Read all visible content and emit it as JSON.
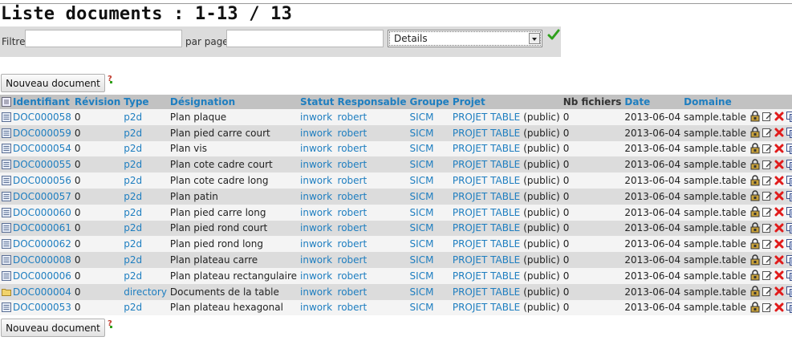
{
  "page_title": "Liste documents : 1-13 / 13",
  "filter": {
    "filtre_label": "Filtre",
    "filtre_value": "",
    "par_page_label": "par page",
    "par_page_value": "",
    "view_selected": "Details"
  },
  "new_button_label": "Nouveau document",
  "columns": {
    "identifiant": "Identifiant",
    "revision": "Révision",
    "type": "Type",
    "designation": "Désignation",
    "statut": "Statut",
    "responsable": "Responsable",
    "groupe": "Groupe",
    "projet": "Projet",
    "nb_fichiers": "Nb fichiers",
    "date": "Date",
    "domaine": "Domaine"
  },
  "rows": [
    {
      "id": "DOC000058",
      "rev": "0",
      "type": "p2d",
      "icon": "document-icon",
      "designation": "Plan plaque",
      "statut": "inwork",
      "responsable": "robert",
      "groupe": "SICM",
      "projet": "PROJET TABLE",
      "visibilite": "(public)",
      "nb": "0",
      "date": "2013-06-04",
      "domaine": "sample.table"
    },
    {
      "id": "DOC000059",
      "rev": "0",
      "type": "p2d",
      "icon": "document-icon",
      "designation": "Plan pied carre court",
      "statut": "inwork",
      "responsable": "robert",
      "groupe": "SICM",
      "projet": "PROJET TABLE",
      "visibilite": "(public)",
      "nb": "0",
      "date": "2013-06-04",
      "domaine": "sample.table"
    },
    {
      "id": "DOC000054",
      "rev": "0",
      "type": "p2d",
      "icon": "document-icon",
      "designation": "Plan vis",
      "statut": "inwork",
      "responsable": "robert",
      "groupe": "SICM",
      "projet": "PROJET TABLE",
      "visibilite": "(public)",
      "nb": "0",
      "date": "2013-06-04",
      "domaine": "sample.table"
    },
    {
      "id": "DOC000055",
      "rev": "0",
      "type": "p2d",
      "icon": "document-icon",
      "designation": "Plan cote cadre court",
      "statut": "inwork",
      "responsable": "robert",
      "groupe": "SICM",
      "projet": "PROJET TABLE",
      "visibilite": "(public)",
      "nb": "0",
      "date": "2013-06-04",
      "domaine": "sample.table"
    },
    {
      "id": "DOC000056",
      "rev": "0",
      "type": "p2d",
      "icon": "document-icon",
      "designation": "Plan cote cadre long",
      "statut": "inwork",
      "responsable": "robert",
      "groupe": "SICM",
      "projet": "PROJET TABLE",
      "visibilite": "(public)",
      "nb": "0",
      "date": "2013-06-04",
      "domaine": "sample.table"
    },
    {
      "id": "DOC000057",
      "rev": "0",
      "type": "p2d",
      "icon": "document-icon",
      "designation": "Plan patin",
      "statut": "inwork",
      "responsable": "robert",
      "groupe": "SICM",
      "projet": "PROJET TABLE",
      "visibilite": "(public)",
      "nb": "0",
      "date": "2013-06-04",
      "domaine": "sample.table"
    },
    {
      "id": "DOC000060",
      "rev": "0",
      "type": "p2d",
      "icon": "document-icon",
      "designation": "Plan pied carre long",
      "statut": "inwork",
      "responsable": "robert",
      "groupe": "SICM",
      "projet": "PROJET TABLE",
      "visibilite": "(public)",
      "nb": "0",
      "date": "2013-06-04",
      "domaine": "sample.table"
    },
    {
      "id": "DOC000061",
      "rev": "0",
      "type": "p2d",
      "icon": "document-icon",
      "designation": "Plan pied rond court",
      "statut": "inwork",
      "responsable": "robert",
      "groupe": "SICM",
      "projet": "PROJET TABLE",
      "visibilite": "(public)",
      "nb": "0",
      "date": "2013-06-04",
      "domaine": "sample.table"
    },
    {
      "id": "DOC000062",
      "rev": "0",
      "type": "p2d",
      "icon": "document-icon",
      "designation": "Plan pied rond long",
      "statut": "inwork",
      "responsable": "robert",
      "groupe": "SICM",
      "projet": "PROJET TABLE",
      "visibilite": "(public)",
      "nb": "0",
      "date": "2013-06-04",
      "domaine": "sample.table"
    },
    {
      "id": "DOC000008",
      "rev": "0",
      "type": "p2d",
      "icon": "document-icon",
      "designation": "Plan plateau carre",
      "statut": "inwork",
      "responsable": "robert",
      "groupe": "SICM",
      "projet": "PROJET TABLE",
      "visibilite": "(public)",
      "nb": "0",
      "date": "2013-06-04",
      "domaine": "sample.table"
    },
    {
      "id": "DOC000006",
      "rev": "0",
      "type": "p2d",
      "icon": "document-icon",
      "designation": "Plan plateau rectangulaire",
      "statut": "inwork",
      "responsable": "robert",
      "groupe": "SICM",
      "projet": "PROJET TABLE",
      "visibilite": "(public)",
      "nb": "0",
      "date": "2013-06-04",
      "domaine": "sample.table"
    },
    {
      "id": "DOC000004",
      "rev": "0",
      "type": "directory",
      "icon": "folder-icon",
      "designation": "Documents de la table",
      "statut": "inwork",
      "responsable": "robert",
      "groupe": "SICM",
      "projet": "PROJET TABLE",
      "visibilite": "(public)",
      "nb": "0",
      "date": "2013-06-04",
      "domaine": "sample.table"
    },
    {
      "id": "DOC000053",
      "rev": "0",
      "type": "p2d",
      "icon": "document-icon",
      "designation": "Plan plateau hexagonal",
      "statut": "inwork",
      "responsable": "robert",
      "groupe": "SICM",
      "projet": "PROJET TABLE",
      "visibilite": "(public)",
      "nb": "0",
      "date": "2013-06-04",
      "domaine": "sample.table"
    }
  ],
  "row_actions": [
    "lock-icon",
    "edit-icon",
    "delete-icon",
    "copy-icon",
    "clipboard-icon"
  ],
  "colors": {
    "link": "#1e7ec0",
    "header_bg": "#c2c2c2",
    "row_odd": "#dcdcdc",
    "row_even": "#f4f4f4",
    "delete": "#e11b1b",
    "check": "#2fa01c"
  }
}
